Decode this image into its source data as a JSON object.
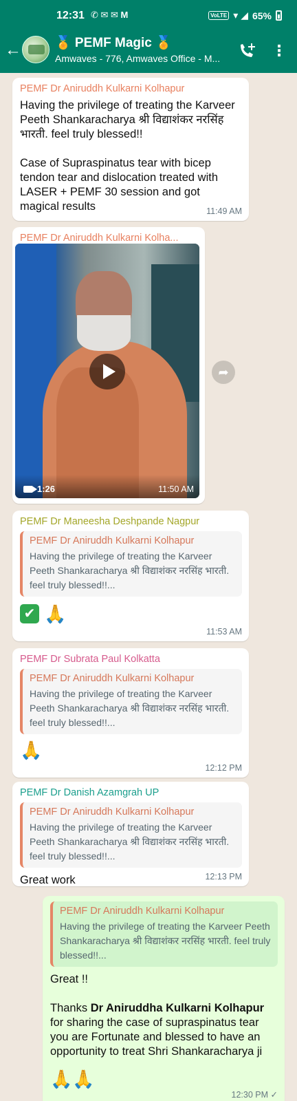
{
  "status_bar": {
    "time": "12:31",
    "left_icons": "✆ ✉ ✉ M",
    "volte": "VoLTE",
    "right_icons": "▾ ◢",
    "battery": "65%"
  },
  "header": {
    "title": "🏅 PEMF Magic 🏅",
    "subtitle": "Amwaves - 776, Amwaves Office - M...",
    "back_icon": "←",
    "menu_icon": "⋮"
  },
  "messages": [
    {
      "sender": "PEMF Dr Aniruddh Kulkarni Kolhapur",
      "sender_color": "#e8805f",
      "text": "Having the privilege of treating the Karveer Peeth Shankaracharya श्री विद्याशंकर नरसिंह भारती. feel truly blessed!!\n\nCase of Supraspinatus tear with bicep tendon tear and dislocation treated with LASER + PEMF 30 session and got magical results",
      "time": "11:49 AM"
    },
    {
      "sender": "PEMF Dr Aniruddh Kulkarni Kolha...",
      "sender_color": "#e8805f",
      "video_duration": "1:26",
      "time": "11:50 AM",
      "forward_icon": "➦"
    },
    {
      "sender": "PEMF Dr Maneesha Deshpande Nagpur",
      "sender_color": "#a3a628",
      "quote_author": "PEMF Dr Aniruddh Kulkarni Kolhapur",
      "quote_text": "Having the privilege of treating the Karveer Peeth Shankaracharya श्री विद्याशंकर नरसिंह भारती. feel truly blessed!!...",
      "emoji_check": "✔",
      "emoji_pray": "🙏",
      "time": "11:53 AM"
    },
    {
      "sender": "PEMF Dr Subrata Paul Kolkatta",
      "sender_color": "#d65a8c",
      "quote_author": "PEMF Dr Aniruddh Kulkarni Kolhapur",
      "quote_text": "Having the privilege of treating the Karveer Peeth Shankaracharya श्री विद्याशंकर नरसिंह भारती. feel truly blessed!!...",
      "emoji_pray": "🙏",
      "time": "12:12 PM"
    },
    {
      "sender": "PEMF Dr Danish Azamgrah UP",
      "sender_color": "#1a9e8c",
      "quote_author": "PEMF Dr Aniruddh Kulkarni Kolhapur",
      "quote_text": "Having the privilege of treating the Karveer Peeth Shankaracharya श्री विद्याशंकर नरसिंह भारती. feel truly blessed!!...",
      "text": "Great work",
      "time": "12:13 PM"
    },
    {
      "quote_author": "PEMF Dr Aniruddh Kulkarni Kolhapur",
      "quote_text": "Having the privilege of treating the Karveer Peeth Shankaracharya श्री विद्याशंकर नरसिंह भारती. feel truly blessed!!...",
      "text_1": "Great !!",
      "text_2_prefix": "Thanks ",
      "text_2_bold": "Dr Aniruddha Kulkarni Kolhapur",
      "text_2_rest": "for sharing the case of supraspinatus tear you are Fortunate and blessed to have an opportunity to treat Shri Shankaracharya ji",
      "emoji_pray": "🙏🙏",
      "time": "12:30 PM",
      "ticks": "✓"
    }
  ],
  "colors": {
    "header_bg": "#008069",
    "chat_bg": "#efe7de",
    "incoming_bubble": "#ffffff",
    "outgoing_bubble": "#e7ffdb"
  }
}
